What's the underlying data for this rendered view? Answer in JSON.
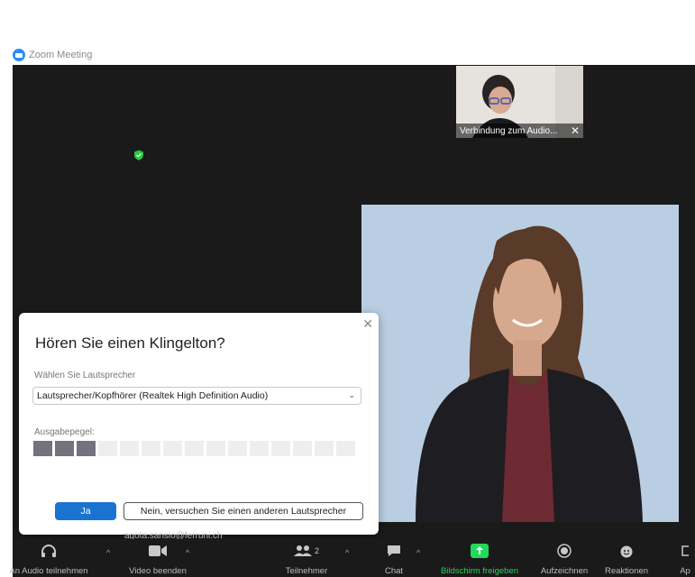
{
  "window": {
    "title": "Zoom Meeting"
  },
  "self_view": {
    "caption": "Verbindung zum Audio..."
  },
  "dialog": {
    "title": "Hören Sie einen Klingelton?",
    "speaker_label": "Wählen Sie Lautsprecher",
    "speaker_value": "Lautsprecher/Kopfhörer (Realtek High Definition Audio)",
    "output_label": "Ausgabepegel:",
    "output_level": {
      "active_segments": 3,
      "total_segments": 15
    },
    "yes_label": "Ja",
    "no_label": "Nein, versuchen Sie einen anderen Lautsprecher"
  },
  "participant_email": "agota.sansio@ferruni.ch",
  "toolbar": {
    "audio_label": "An Audio teilnehmen",
    "video_label": "Video beenden",
    "participants_label": "Teilnehmer",
    "participants_count": "2",
    "chat_label": "Chat",
    "share_label": "Bildschirm freigeben",
    "record_label": "Aufzeichnen",
    "reactions_label": "Reaktionen",
    "apps_label": "Ap"
  },
  "colors": {
    "stage_bg": "#1a1a1a",
    "accent_blue": "#1a73d1",
    "share_green": "#23d959",
    "shield_green": "#28c840"
  }
}
